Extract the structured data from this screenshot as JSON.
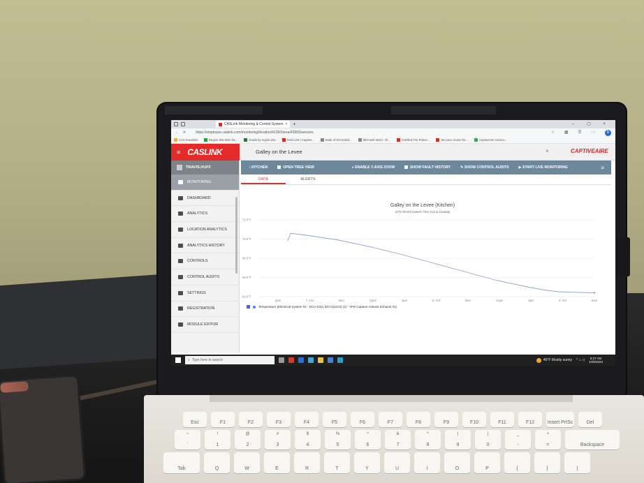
{
  "browser": {
    "tab_title": "CASLink Monitoring & Control System",
    "url": "https://employee.caslink.com/monitoring/location/41392/area/43955/sensors",
    "favorites": [
      "CAS Favorites",
      "Region 303 SDV Sa...",
      "Scada by region.xlsx",
      "Field Link | Captive...",
      "State of OH-Indivd...",
      "Microsoft Word - El...",
      "Certified Fire Protec...",
      "Set your course for...",
      "CaptiveAire Service..."
    ]
  },
  "app": {
    "logo": "CASLINK",
    "location_name": "Galley on the Levee",
    "brand": "CAPTIVEAIRE",
    "user": "TRAVIS.HUFF"
  },
  "sidebar": {
    "items": [
      "MONITORING",
      "DASHBOARD",
      "ANALYTICS",
      "LOCATION ANALYTICS",
      "ANALYTICS HISTORY",
      "CONTROLS",
      "CONTROL AUDITS",
      "SETTINGS",
      "REGISTRATION",
      "MODULE EDITOR"
    ]
  },
  "toolbar": {
    "back": "KITCHEN",
    "tree": "OPEN TREE VIEW",
    "zoom": "ENABLE Y-AXIS ZOOM",
    "fault": "SHOW FAULT HISTORY",
    "audits": "SHOW CONTROL AUDITS",
    "live": "START LIVE MONITORING"
  },
  "subtabs": [
    "DATA",
    "ALERTS"
  ],
  "chart_data": {
    "type": "line",
    "title": "Galley on the Levee (Kitchen)",
    "subtitle": "(UTC-05:00) Eastern Time (US & Canada)",
    "yticks": [
      "64.0°F",
      "66.0°F",
      "68.0°F",
      "70.0°F",
      "72.0°F"
    ],
    "ylim": [
      64,
      72
    ],
    "xticks": [
      "6pm",
      "7. Oct",
      "6am",
      "12pm",
      "6pm",
      "8. Oct",
      "6am",
      "12pm",
      "6pm",
      "9. Oct",
      "6am"
    ],
    "series": [
      {
        "name": "Temperature (Electrical System #2 - DCV-1011 (DCV111C0) (1) - VFD Capture Volume Exhaust #1)",
        "x": [
          0.9,
          1.0,
          1.5,
          2.5,
          3.5,
          4.5,
          5.5,
          6.5,
          7.5,
          8.5,
          9.0,
          9.5,
          10.0,
          10.6
        ],
        "y": [
          69.8,
          70.6,
          70.4,
          69.9,
          69.2,
          68.4,
          67.5,
          66.6,
          65.7,
          65.0,
          64.7,
          64.5,
          64.45,
          64.4
        ]
      }
    ],
    "grid": true
  },
  "taskbar": {
    "search_placeholder": "Type here to search",
    "weather": "46°F Mostly sunny",
    "time": "9:27 AM",
    "date": "10/9/2023"
  },
  "keyboard": {
    "row1": [
      "Esc",
      "F1",
      "F2",
      "F3",
      "F4",
      "F5",
      "F6",
      "F7",
      "F8",
      "F9",
      "F10",
      "F11",
      "F12",
      "Insert PrtSc",
      "Del"
    ],
    "row2_top": [
      "~",
      "!",
      "@",
      "#",
      "$",
      "%",
      "^",
      "&",
      "*",
      "(",
      ")",
      "_",
      "+",
      ""
    ],
    "row2": [
      "`",
      "1",
      "2",
      "3",
      "4",
      "5",
      "6",
      "7",
      "8",
      "9",
      "0",
      "-",
      "=",
      "Backspace"
    ],
    "row3": [
      "Tab",
      "Q",
      "W",
      "E",
      "R",
      "T",
      "Y",
      "U",
      "I",
      "O",
      "P",
      "{",
      "}",
      "|"
    ]
  },
  "colors": {
    "brand_red": "#e32b2a",
    "toolbar_blue": "#6e889b",
    "series_line": "#8fa2d6"
  }
}
